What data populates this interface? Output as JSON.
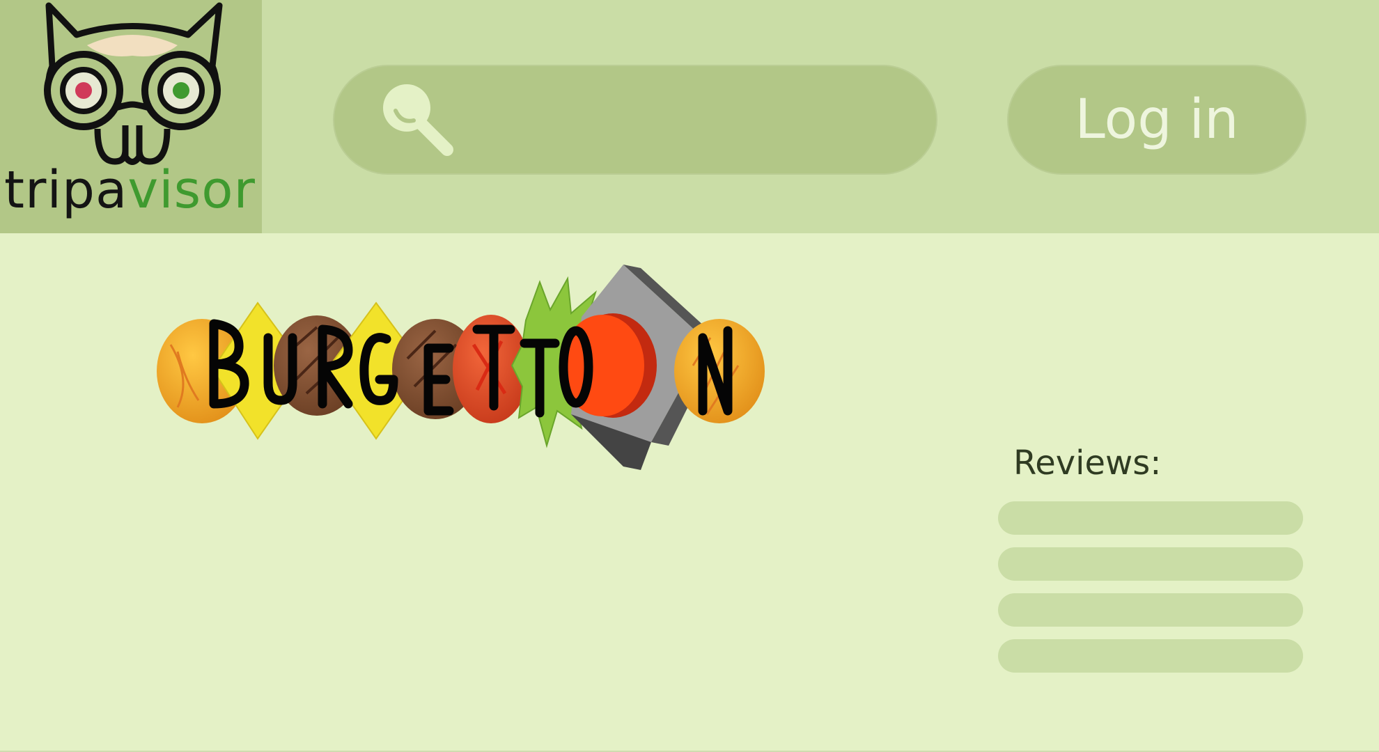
{
  "header": {
    "logo": {
      "text_part1": "tripa",
      "text_part2": "visor",
      "icon": "owl-logo-icon"
    },
    "search": {
      "icon": "search-icon",
      "value": ""
    },
    "login_label": "Log in"
  },
  "main": {
    "brand": {
      "letters": [
        "B",
        "U",
        "R",
        "G",
        "E",
        "T",
        "T",
        "O",
        "N"
      ],
      "icon": "burgetton-logo"
    },
    "reviews": {
      "title": "Reviews:",
      "items": [
        "",
        "",
        "",
        ""
      ]
    }
  },
  "colors": {
    "header_bg": "#cadda6",
    "page_bg": "#e4f1c6",
    "accent": "#b2c787",
    "brand_green": "#3f9a2f"
  }
}
